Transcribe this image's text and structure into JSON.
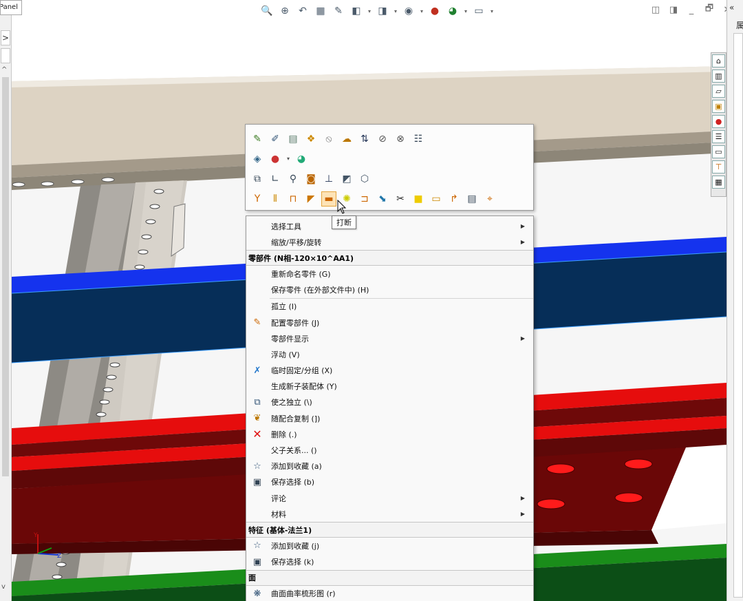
{
  "left_panel": {
    "tab_label": "Panel",
    "arrow": ">",
    "scroll_up": "^",
    "scroll_down": "v"
  },
  "heads_up_toolbar": {
    "icons": [
      "zoom-to-fit-icon",
      "zoom-to-area-icon",
      "previous-view-icon",
      "section-view-icon",
      "dynamic-annotation-icon",
      "view-orientation-icon",
      "display-style-icon",
      "hide-show-items-icon",
      "edit-appearance-icon",
      "apply-scene-icon",
      "view-settings-icon"
    ]
  },
  "window_controls": {
    "icons": [
      "tile-left-icon",
      "tile-right-icon",
      "minimize-icon",
      "restore-icon",
      "close-icon"
    ],
    "close": "✕",
    "minimize": "_",
    "restore": "🗗"
  },
  "task_pane_tabs": [
    "home-icon",
    "design-library-icon",
    "file-explorer-icon",
    "view-palette-icon",
    "appearances-icon",
    "custom-properties-icon",
    "forum-icon",
    "weldments-icon",
    "grid-icon"
  ],
  "right_strip": {
    "collapse": "«",
    "label": "属"
  },
  "context_toolbar": {
    "rows": [
      [
        "edit-part-icon",
        "edit-feature-icon",
        "open-part-icon",
        "edit-appearance-icon",
        "hide-icon",
        "isolate-icon",
        "sort-icon",
        "mate-icon",
        "mate-references-icon",
        "properties-icon"
      ],
      [
        "component-icon",
        "appearance-icon",
        "dropdown-icon",
        "appearance-callout-icon"
      ],
      [
        "copy-icon",
        "sketch-icon",
        "zoom-to-selection-icon",
        "normal-to-icon",
        "arrow-down-icon",
        "transparency-icon",
        "box-icon"
      ],
      [
        "trim-icon",
        "extend-icon",
        "structural-member-icon",
        "gusset-icon",
        "break-icon",
        "weld-bead-icon",
        "end-cap-icon",
        "move-icon",
        "cut-icon",
        "face-icon",
        "slot-icon",
        "hook-icon",
        "table-icon",
        "measure-icon"
      ]
    ],
    "tooltip": "打断"
  },
  "context_menu": {
    "items_top": [
      {
        "label": "选择工具",
        "submenu": true
      },
      {
        "label": "缩放/平移/旋转",
        "submenu": true
      }
    ],
    "section_component": "零部件 (N相-120×10^AA1)",
    "items_component": [
      {
        "label": "重新命名零件 (G)",
        "icon": ""
      },
      {
        "label": "保存零件 (在外部文件中) (H)",
        "icon": ""
      },
      {
        "label": "孤立 (I)",
        "icon": ""
      },
      {
        "label": "配置零部件 (J)",
        "icon": "configure-component-icon"
      },
      {
        "label": "零部件显示",
        "icon": "",
        "submenu": true
      },
      {
        "label": "浮动 (V)",
        "icon": ""
      },
      {
        "label": "临时固定/分组 (X)",
        "icon": "temp-fix-icon"
      },
      {
        "label": "生成新子装配体 (Y)",
        "icon": ""
      },
      {
        "label": "使之独立 (\\)",
        "icon": "make-independent-icon"
      },
      {
        "label": "随配合复制 (])",
        "icon": "copy-with-mates-icon"
      },
      {
        "label": "删除 (.)",
        "icon": "delete-icon"
      },
      {
        "label": "父子关系... ()",
        "icon": ""
      },
      {
        "label": "添加到收藏 (a)",
        "icon": "favorite-icon"
      },
      {
        "label": "保存选择 (b)",
        "icon": "save-selection-icon"
      },
      {
        "label": "评论",
        "icon": "",
        "submenu": true
      },
      {
        "label": "材料",
        "icon": "",
        "submenu": true
      }
    ],
    "section_feature": "特征 (基体-法兰1)",
    "items_feature": [
      {
        "label": "添加到收藏 (j)",
        "icon": "favorite-icon"
      },
      {
        "label": "保存选择 (k)",
        "icon": "save-selection-icon"
      }
    ],
    "section_face": "面",
    "items_face": [
      {
        "label": "曲面曲率梳形图 (r)",
        "icon": "curvature-icon"
      }
    ]
  },
  "triad": {
    "x": "X",
    "y": "Y",
    "z": "Z"
  },
  "colors": {
    "blue_beam": "#0a2f5a",
    "blue_edge": "#1533ee",
    "red_beam": "#6a0707",
    "red_top": "#e00e0e",
    "green_beam": "#0d5a1a",
    "tan_beam": "#ddd3c3"
  }
}
